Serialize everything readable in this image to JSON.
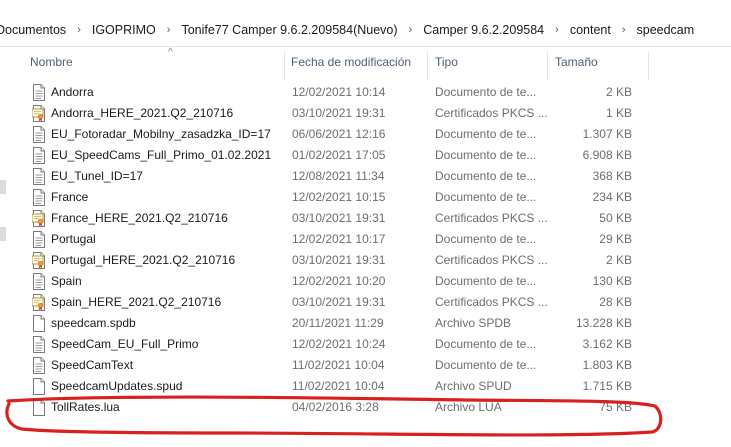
{
  "breadcrumb": {
    "items": [
      "Documentos",
      "IGOPRIMO",
      "Tonife77 Camper 9.6.2.209584(Nuevo)",
      "Camper 9.6.2.209584",
      "content",
      "speedcam"
    ],
    "separator": "›"
  },
  "columns": {
    "name": "Nombre",
    "date": "Fecha de modificación",
    "type": "Tipo",
    "size": "Tamaño"
  },
  "files": [
    {
      "name": "Andorra",
      "date": "12/02/2021 10:14",
      "type": "Documento de te...",
      "size": "2 KB",
      "icon": "text-file-icon"
    },
    {
      "name": "Andorra_HERE_2021.Q2_210716",
      "date": "03/10/2021 19:31",
      "type": "Certificados PKCS ...",
      "size": "1 KB",
      "icon": "certificate-file-icon"
    },
    {
      "name": "EU_Fotoradar_Mobilny_zasadzka_ID=17",
      "date": "06/06/2021 12:16",
      "type": "Documento de te...",
      "size": "1.307 KB",
      "icon": "text-file-icon"
    },
    {
      "name": "EU_SpeedCams_Full_Primo_01.02.2021",
      "date": "01/02/2021 17:05",
      "type": "Documento de te...",
      "size": "6.908 KB",
      "icon": "text-file-icon"
    },
    {
      "name": "EU_Tunel_ID=17",
      "date": "12/08/2021 11:34",
      "type": "Documento de te...",
      "size": "368 KB",
      "icon": "text-file-icon"
    },
    {
      "name": "France",
      "date": "12/02/2021 10:15",
      "type": "Documento de te...",
      "size": "234 KB",
      "icon": "text-file-icon"
    },
    {
      "name": "France_HERE_2021.Q2_210716",
      "date": "03/10/2021 19:31",
      "type": "Certificados PKCS ...",
      "size": "50 KB",
      "icon": "certificate-file-icon"
    },
    {
      "name": "Portugal",
      "date": "12/02/2021 10:17",
      "type": "Documento de te...",
      "size": "29 KB",
      "icon": "text-file-icon"
    },
    {
      "name": "Portugal_HERE_2021.Q2_210716",
      "date": "03/10/2021 19:31",
      "type": "Certificados PKCS ...",
      "size": "2 KB",
      "icon": "certificate-file-icon"
    },
    {
      "name": "Spain",
      "date": "12/02/2021 10:20",
      "type": "Documento de te...",
      "size": "130 KB",
      "icon": "text-file-icon"
    },
    {
      "name": "Spain_HERE_2021.Q2_210716",
      "date": "03/10/2021 19:31",
      "type": "Certificados PKCS ...",
      "size": "28 KB",
      "icon": "certificate-file-icon"
    },
    {
      "name": "speedcam.spdb",
      "date": "20/11/2021 11:29",
      "type": "Archivo SPDB",
      "size": "13.228 KB",
      "icon": "blank-file-icon"
    },
    {
      "name": "SpeedCam_EU_Full_Primo",
      "date": "12/02/2021 10:24",
      "type": "Documento de te...",
      "size": "3.162 KB",
      "icon": "text-file-icon"
    },
    {
      "name": "SpeedCamText",
      "date": "11/02/2021 10:04",
      "type": "Documento de te...",
      "size": "1.803 KB",
      "icon": "text-file-icon"
    },
    {
      "name": "SpeedcamUpdates.spud",
      "date": "11/02/2021 10:04",
      "type": "Archivo SPUD",
      "size": "1.715 KB",
      "icon": "blank-file-icon"
    },
    {
      "name": "TollRates.lua",
      "date": "04/02/2016 3:28",
      "type": "Archivo LUA",
      "size": "75 KB",
      "icon": "blank-file-icon"
    }
  ],
  "colors": {
    "header_text": "#4c607a",
    "annotation": "#d9201f",
    "cert_ribbon": "#e8a33c"
  }
}
